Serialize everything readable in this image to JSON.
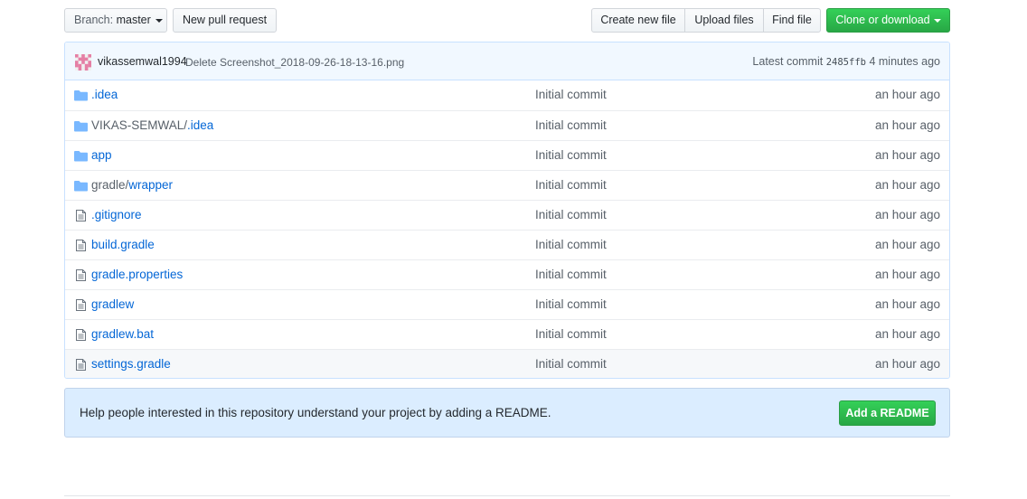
{
  "toolbar": {
    "branch_label": "Branch:",
    "branch_value": "master",
    "new_pr": "New pull request",
    "create_file": "Create new file",
    "upload_files": "Upload files",
    "find_file": "Find file",
    "clone": "Clone or download"
  },
  "commit": {
    "author": "vikassemwal1994",
    "message": "Delete Screenshot_2018-09-26-18-13-16.png",
    "latest_label": "Latest commit",
    "sha": "2485ffb",
    "age": "4 minutes ago"
  },
  "files": [
    {
      "prefix": "",
      "name": ".idea",
      "type": "folder",
      "message": "Initial commit",
      "age": "an hour ago"
    },
    {
      "prefix": "VIKAS-SEMWAL/",
      "name": ".idea",
      "type": "folder",
      "message": "Initial commit",
      "age": "an hour ago"
    },
    {
      "prefix": "",
      "name": "app",
      "type": "folder",
      "message": "Initial commit",
      "age": "an hour ago"
    },
    {
      "prefix": "gradle/",
      "name": "wrapper",
      "type": "folder",
      "message": "Initial commit",
      "age": "an hour ago"
    },
    {
      "prefix": "",
      "name": ".gitignore",
      "type": "file",
      "message": "Initial commit",
      "age": "an hour ago"
    },
    {
      "prefix": "",
      "name": "build.gradle",
      "type": "file",
      "message": "Initial commit",
      "age": "an hour ago"
    },
    {
      "prefix": "",
      "name": "gradle.properties",
      "type": "file",
      "message": "Initial commit",
      "age": "an hour ago"
    },
    {
      "prefix": "",
      "name": "gradlew",
      "type": "file",
      "message": "Initial commit",
      "age": "an hour ago"
    },
    {
      "prefix": "",
      "name": "gradlew.bat",
      "type": "file",
      "message": "Initial commit",
      "age": "an hour ago"
    },
    {
      "prefix": "",
      "name": "settings.gradle",
      "type": "file",
      "message": "Initial commit",
      "age": "an hour ago"
    }
  ],
  "readme": {
    "text": "Help people interested in this repository understand your project by adding a README.",
    "button": "Add a README"
  },
  "colors": {
    "link": "#0366d6",
    "green": "#28a745",
    "folder_icon": "#79b8ff",
    "avatar": "#e57fa5"
  }
}
